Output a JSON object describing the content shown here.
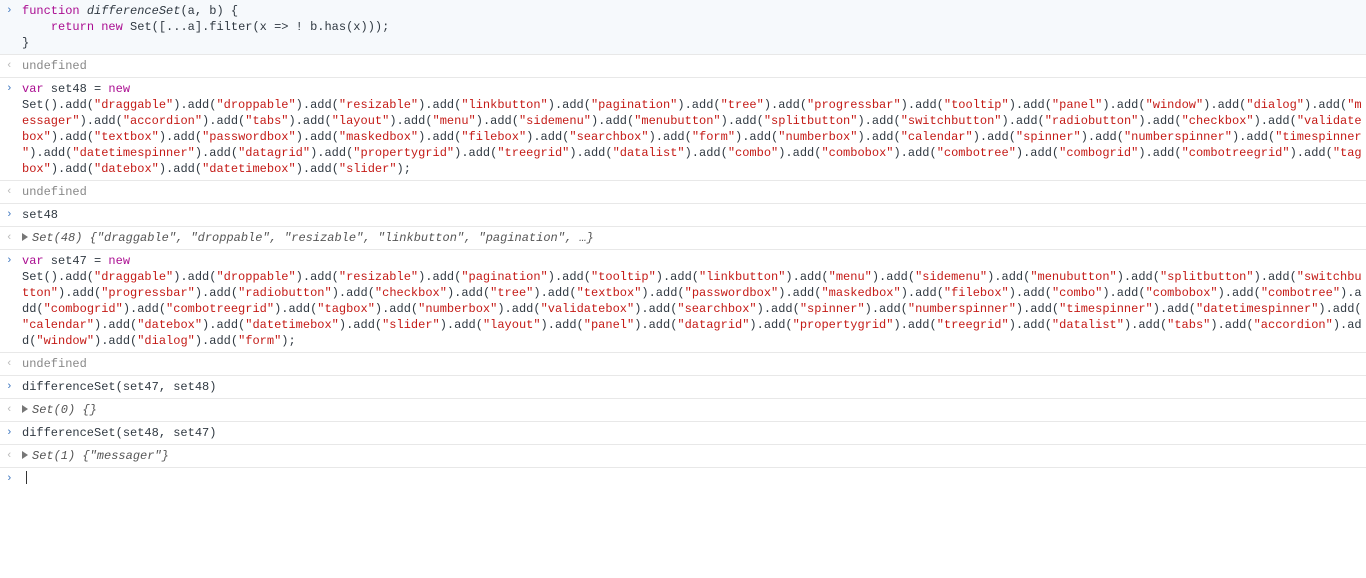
{
  "markers": {
    "in": "›",
    "out": "‹"
  },
  "kw": {
    "function": "function",
    "return": "return",
    "new": "new",
    "var": "var"
  },
  "entries": [
    {
      "type": "in",
      "fnName": "differenceSet",
      "params": "(a, b) {",
      "line2_pre": "    ",
      "setCtor": "Set",
      "filterBody": "([...a].filter(x => ! b.has(x)));",
      "close": "}"
    },
    {
      "type": "out-undef",
      "text": "undefined"
    },
    {
      "type": "in-setdef",
      "varName": " set48 = ",
      "ctor": "Set",
      "openCall": "().add(",
      "strings": [
        "draggable",
        "droppable",
        "resizable",
        "linkbutton",
        "pagination",
        "tree",
        "progressbar",
        "tooltip",
        "panel",
        "window",
        "dialog",
        "messager",
        "accordion",
        "tabs",
        "layout",
        "menu",
        "sidemenu",
        "menubutton",
        "splitbutton",
        "switchbutton",
        "radiobutton",
        "checkbox",
        "validatebox",
        "textbox",
        "passwordbox",
        "maskedbox",
        "filebox",
        "searchbox",
        "form",
        "numberbox",
        "calendar",
        "spinner",
        "numberspinner",
        "timespinner",
        "datetimespinner",
        "datagrid",
        "propertygrid",
        "treegrid",
        "datalist",
        "combo",
        "combobox",
        "combotree",
        "combogrid",
        "combotreegrid",
        "tagbox",
        "datebox",
        "datetimebox",
        "slider"
      ],
      "sep": ").add(",
      "end": ");"
    },
    {
      "type": "out-undef",
      "text": "undefined"
    },
    {
      "type": "in-plain",
      "text": "set48"
    },
    {
      "type": "out-set",
      "label": "Set(48) {",
      "items": [
        "draggable",
        "droppable",
        "resizable",
        "linkbutton",
        "pagination"
      ],
      "ellipsis": ", …}",
      "commaSep": ", "
    },
    {
      "type": "in-setdef",
      "varName": " set47 = ",
      "ctor": "Set",
      "openCall": "().add(",
      "strings": [
        "draggable",
        "droppable",
        "resizable",
        "pagination",
        "tooltip",
        "linkbutton",
        "menu",
        "sidemenu",
        "menubutton",
        "splitbutton",
        "switchbutton",
        "progressbar",
        "radiobutton",
        "checkbox",
        "tree",
        "textbox",
        "passwordbox",
        "maskedbox",
        "filebox",
        "combo",
        "combobox",
        "combotree",
        "combogrid",
        "combotreegrid",
        "tagbox",
        "numberbox",
        "validatebox",
        "searchbox",
        "spinner",
        "numberspinner",
        "timespinner",
        "datetimespinner",
        "calendar",
        "datebox",
        "datetimebox",
        "slider",
        "layout",
        "panel",
        "datagrid",
        "propertygrid",
        "treegrid",
        "datalist",
        "tabs",
        "accordion",
        "window",
        "dialog",
        "form"
      ],
      "sep": ").add(",
      "end": ");"
    },
    {
      "type": "out-undef",
      "text": "undefined"
    },
    {
      "type": "in-plain",
      "text": "differenceSet(set47, set48)"
    },
    {
      "type": "out-set",
      "label": "Set(0) {}",
      "items": [],
      "ellipsis": "",
      "commaSep": ""
    },
    {
      "type": "in-plain",
      "text": "differenceSet(set48, set47)"
    },
    {
      "type": "out-set",
      "label": "Set(1) {",
      "items": [
        "messager"
      ],
      "ellipsis": "}",
      "commaSep": ", "
    },
    {
      "type": "prompt"
    }
  ]
}
